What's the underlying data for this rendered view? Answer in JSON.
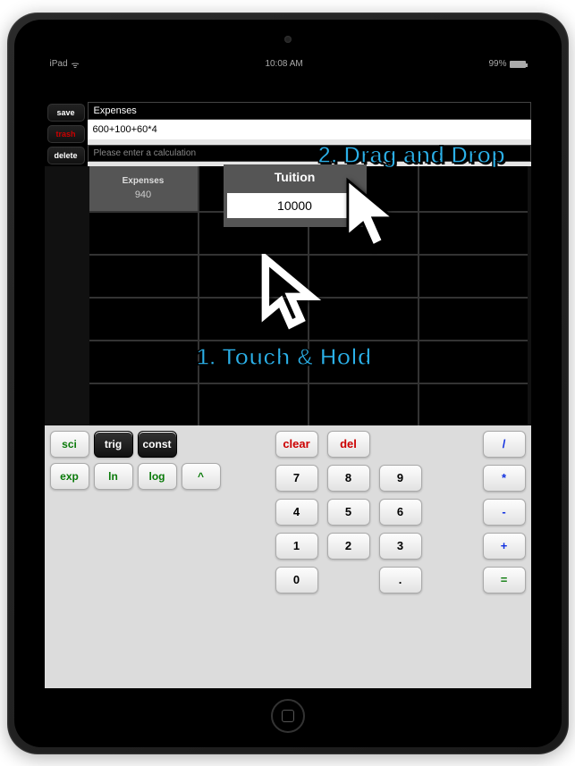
{
  "status": {
    "device": "iPad",
    "time": "10:08 AM",
    "battery": "99%"
  },
  "sidebar": {
    "save": "save",
    "trash": "trash",
    "delete": "delete"
  },
  "expression": {
    "title": "Expenses",
    "value": "600+100+60*4",
    "hint": "Please enter a calculation"
  },
  "table": {
    "headers": [
      {
        "name": "Expenses",
        "value": "940"
      },
      {
        "name": "Tuition",
        "value": "10000"
      }
    ]
  },
  "tooltip": {
    "title": "Tuition",
    "value": "10000"
  },
  "annotations": {
    "step1": "1. Touch & Hold",
    "step2": "2. Drag and Drop"
  },
  "funcKeys": {
    "row1": [
      "sci",
      "trig",
      "const"
    ],
    "row2": [
      "exp",
      "ln",
      "log",
      "^"
    ]
  },
  "numKeys": {
    "clear": "clear",
    "del": "del",
    "n7": "7",
    "n8": "8",
    "n9": "9",
    "div": "/",
    "n4": "4",
    "n5": "5",
    "n6": "6",
    "mul": "*",
    "n1": "1",
    "n2": "2",
    "n3": "3",
    "sub": "-",
    "n0": "0",
    "dot": ".",
    "plus": "+",
    "eq": "="
  }
}
